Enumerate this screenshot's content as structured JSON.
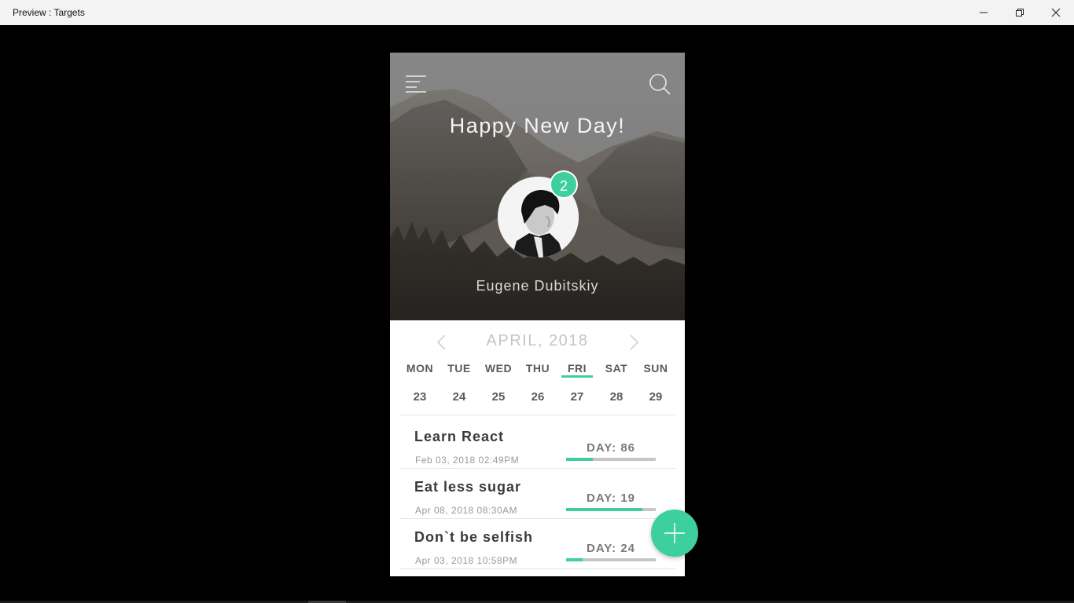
{
  "window": {
    "title": "Preview : Targets",
    "controls": [
      "minimize-icon",
      "restore-icon",
      "close-icon"
    ]
  },
  "header": {
    "greeting": "Happy New Day!",
    "menu_icon": "menu-icon",
    "search_icon": "search-icon",
    "user_name": "Eugene Dubitskiy",
    "notification_count": "2"
  },
  "calendar": {
    "month": "APRIL, 2018",
    "prev_icon": "chevron-left-icon",
    "next_icon": "chevron-right-icon",
    "days": [
      {
        "label": "MON",
        "date": "23"
      },
      {
        "label": "TUE",
        "date": "24"
      },
      {
        "label": "WED",
        "date": "25"
      },
      {
        "label": "THU",
        "date": "26"
      },
      {
        "label": "FRI",
        "date": "27",
        "selected": true
      },
      {
        "label": "SAT",
        "date": "28"
      },
      {
        "label": "SUN",
        "date": "29"
      }
    ]
  },
  "targets": [
    {
      "name": "Learn React",
      "created": "Feb 03, 2018 02:49PM",
      "day_label": "DAY: 86",
      "progress": 0.3
    },
    {
      "name": "Eat less sugar",
      "created": "Apr 08, 2018 08:30AM",
      "day_label": "DAY: 19",
      "progress": 0.85
    },
    {
      "name": "Don`t be selfish",
      "created": "Apr 03, 2018 10:58PM",
      "day_label": "DAY: 24",
      "progress": 0.18
    }
  ],
  "fab": {
    "icon": "plus-icon"
  },
  "colors": {
    "accent": "#3ecf9e",
    "track": "#c6c6c6",
    "text_dark": "#3a3a3a",
    "text_muted": "#9a9a9a"
  }
}
